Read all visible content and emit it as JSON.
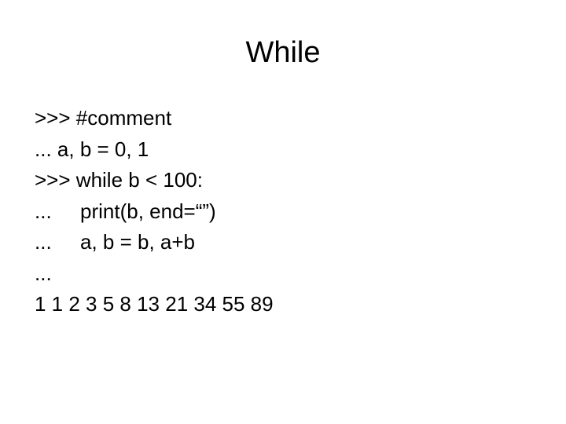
{
  "slide": {
    "title": "While",
    "lines": [
      {
        "prompt": ">>>",
        "code": "#comment",
        "indented": false
      },
      {
        "prompt": "...",
        "code": "a, b = 0, 1",
        "indented": false
      },
      {
        "prompt": ">>>",
        "code": "while b < 100:",
        "indented": false
      },
      {
        "prompt": "...",
        "code": "print(b, end=“”)",
        "indented": true
      },
      {
        "prompt": "...",
        "code": "a, b = b, a+b",
        "indented": true
      },
      {
        "prompt": "...",
        "code": "",
        "indented": false
      },
      {
        "prompt": "",
        "code": "1 1 2 3 5 8 13 21 34 55 89",
        "indented": false
      }
    ]
  }
}
